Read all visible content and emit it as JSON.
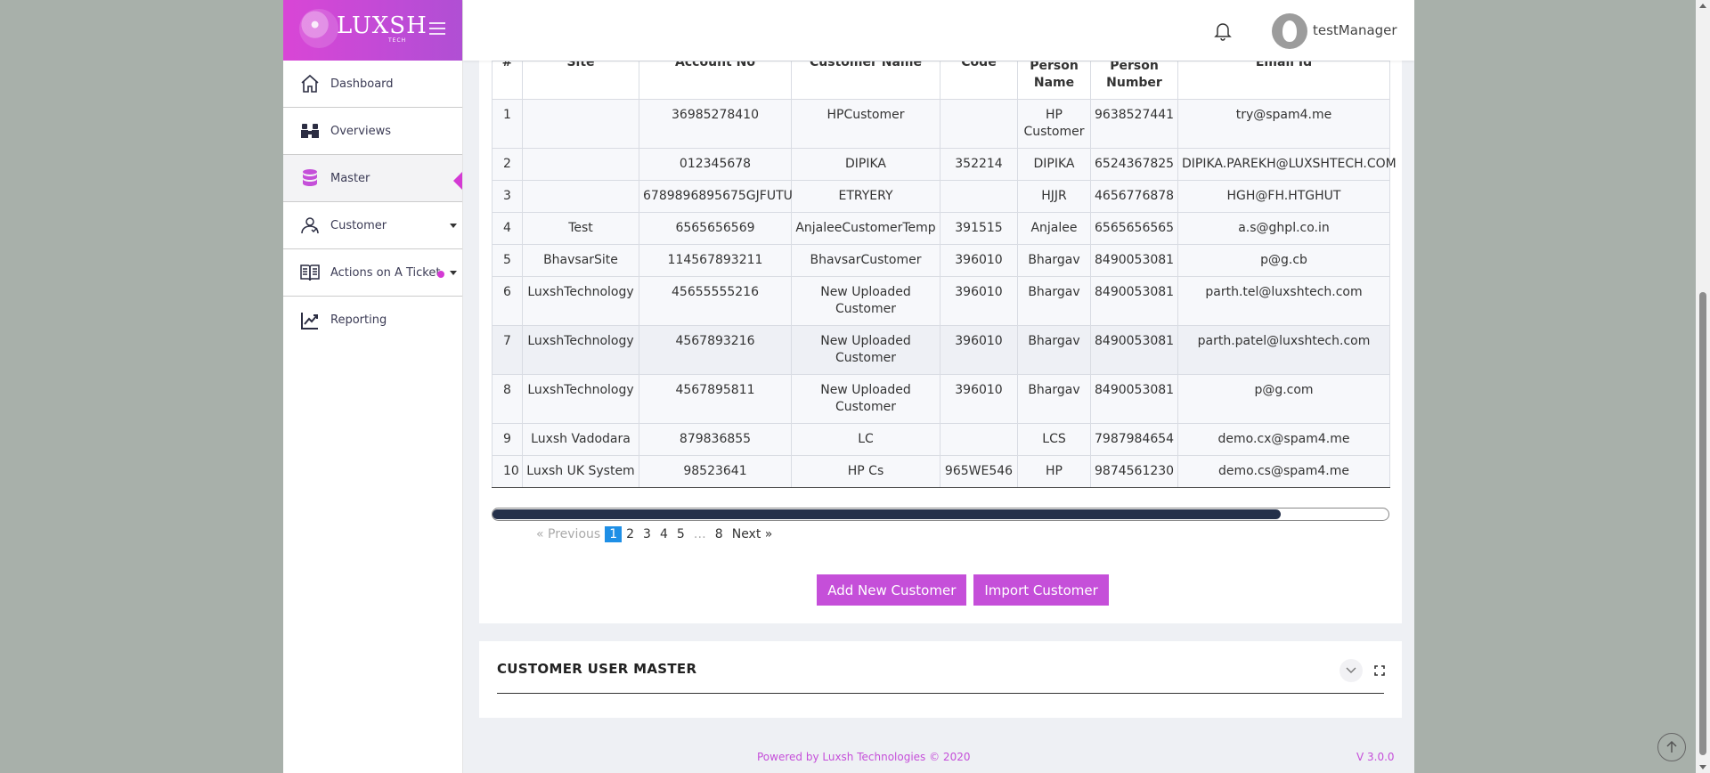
{
  "brand": {
    "name": "LUXSH",
    "sub": "TECH",
    "logo_icon": "globe-logo-icon"
  },
  "header": {
    "username": "testManager"
  },
  "sidebar": {
    "items": [
      {
        "label": "Dashboard",
        "icon": "home-icon"
      },
      {
        "label": "Overviews",
        "icon": "binoculars-icon"
      },
      {
        "label": "Master",
        "icon": "database-icon",
        "active": true
      },
      {
        "label": "Customer",
        "icon": "users-icon",
        "has_caret": true
      },
      {
        "label": "Actions on A Ticket",
        "icon": "book-icon",
        "has_caret": true,
        "has_dot": true
      },
      {
        "label": "Reporting",
        "icon": "chart-icon"
      }
    ]
  },
  "table": {
    "headers": [
      "#",
      "Site",
      "Account No",
      "Customer Name",
      "Post Code",
      "Person\nName",
      "Person\nNumber",
      "Email Id"
    ],
    "rows": [
      [
        "1",
        "",
        "36985278410",
        "HPCustomer",
        "",
        "HP Customer",
        "9638527441",
        "try@spam4.me"
      ],
      [
        "2",
        "",
        "012345678",
        "DIPIKA",
        "352214",
        "DIPIKA",
        "6524367825",
        "DIPIKA.PAREKH@LUXSHTECH.COM"
      ],
      [
        "3",
        "",
        "6789896895675GJFUTU",
        "ETRYERY",
        "",
        "HJJR",
        "4656776878",
        "HGH@FH.HTGHUT"
      ],
      [
        "4",
        "Test",
        "6565656569",
        "AnjaleeCustomerTemp",
        "391515",
        "Anjalee",
        "6565656565",
        "a.s@ghpl.co.in"
      ],
      [
        "5",
        "BhavsarSite",
        "114567893211",
        "BhavsarCustomer",
        "396010",
        "Bhargav",
        "8490053081",
        "p@g.cb"
      ],
      [
        "6",
        "LuxshTechnology",
        "45655555216",
        "New Uploaded Customer",
        "396010",
        "Bhargav",
        "8490053081",
        "parth.tel@luxshtech.com"
      ],
      [
        "7",
        "LuxshTechnology",
        "4567893216",
        "New Uploaded Customer",
        "396010",
        "Bhargav",
        "8490053081",
        "parth.patel@luxshtech.com"
      ],
      [
        "8",
        "LuxshTechnology",
        "4567895811",
        "New Uploaded Customer",
        "396010",
        "Bhargav",
        "8490053081",
        "p@g.com"
      ],
      [
        "9",
        "Luxsh Vadodara",
        "879836855",
        "LC",
        "",
        "LCS",
        "7987984654",
        "demo.cx@spam4.me"
      ],
      [
        "10",
        "Luxsh UK System",
        "98523641",
        "HP Cs",
        "965WE546",
        "HP",
        "9874561230",
        "demo.cs@spam4.me"
      ]
    ],
    "scroll_fraction": 0.88
  },
  "pager": {
    "previous": "« Previous",
    "pages": [
      "1",
      "3",
      "4",
      "5",
      "…",
      "8"
    ],
    "current": "1",
    "next": "Next »"
  },
  "actions": {
    "add": "Add New Customer",
    "import": "Import Customer"
  },
  "user_master": {
    "title": "CUSTOMER USER MASTER"
  },
  "footer": {
    "powered": "Powered by Luxsh Technologies © 2020",
    "version": "V 3.0.0"
  },
  "colors": {
    "accent": "#c54fd9",
    "pager_active": "#1e8fe6",
    "scroll_thumb": "#24304a"
  }
}
